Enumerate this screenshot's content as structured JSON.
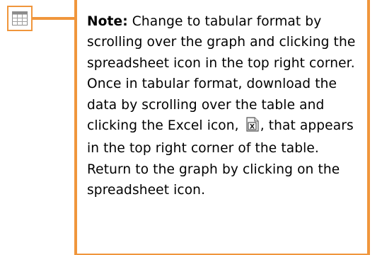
{
  "spreadsheet_icon": {
    "name": "spreadsheet-icon",
    "color": "#8c8c8c"
  },
  "accent_color": "#f0963c",
  "note": {
    "label": "Note:",
    "text_before_icon": " Change to tabular format by scrolling over the graph and clicking the spreadsheet icon in the top right corner. Once in tabular format, download the data by scrolling over the table and clicking the Excel icon,",
    "excel_icon": {
      "name": "excel-icon",
      "glyph": "X"
    },
    "text_after_icon": ", that appears in the top right corner of the table.",
    "return_text": "Return to the graph by clicking on the spreadsheet icon."
  }
}
